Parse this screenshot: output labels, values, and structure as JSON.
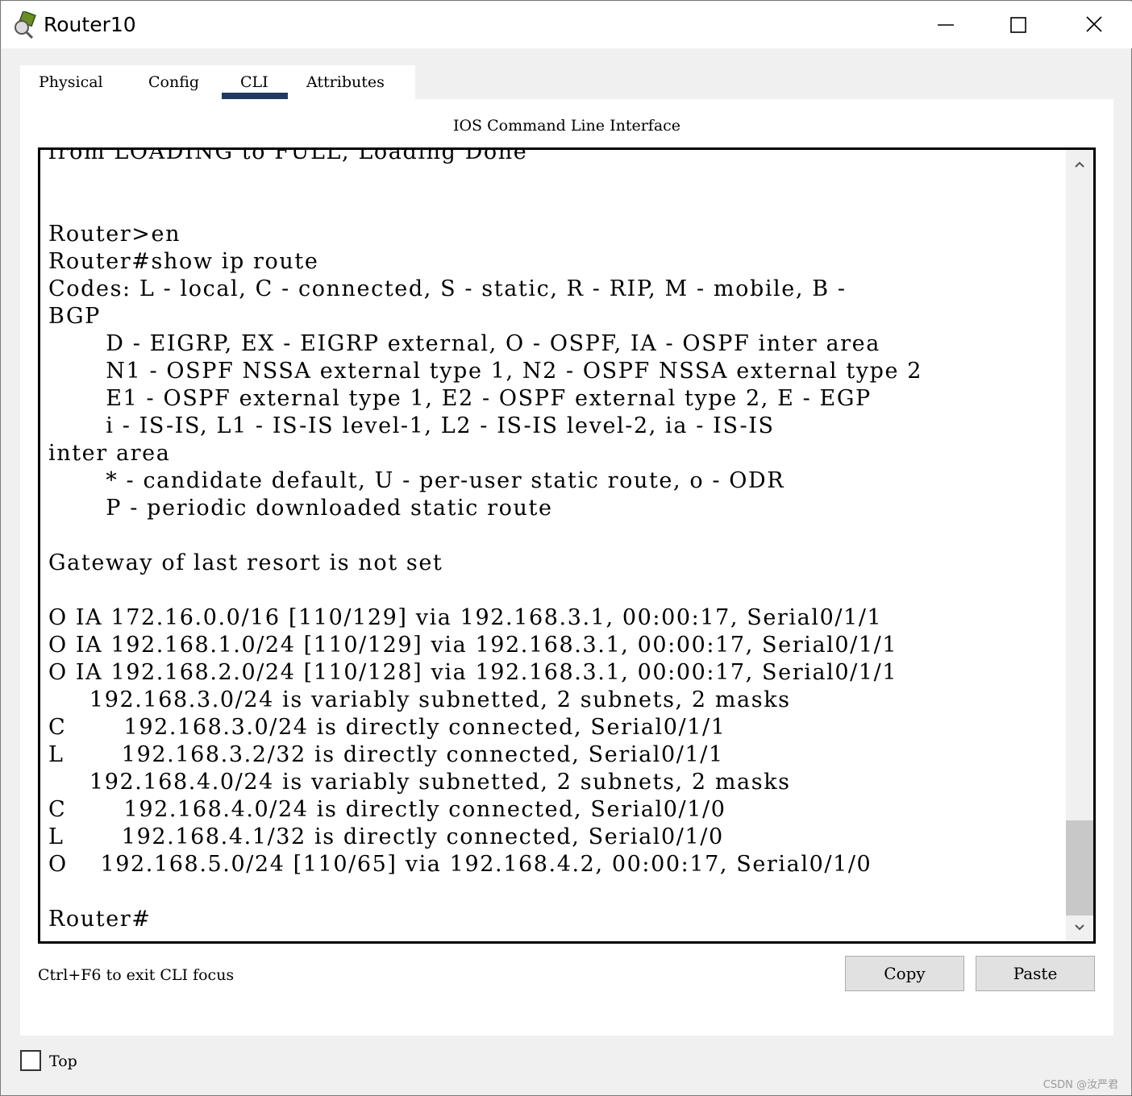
{
  "window": {
    "title": "Router10",
    "icons": {
      "app": "router-app-icon",
      "minimize": "minimize-icon",
      "maximize": "maximize-icon",
      "close": "close-icon"
    }
  },
  "tabs": [
    {
      "label": "Physical"
    },
    {
      "label": "Config"
    },
    {
      "label": "CLI",
      "active": true
    },
    {
      "label": "Attributes"
    }
  ],
  "cli": {
    "heading": "IOS Command Line Interface",
    "lines": [
      "from LOADING to FULL, Loading Done",
      "",
      "",
      "Router>en",
      "Router#show ip route",
      "Codes: L - local, C - connected, S - static, R - RIP, M - mobile, B -",
      "BGP",
      "       D - EIGRP, EX - EIGRP external, O - OSPF, IA - OSPF inter area",
      "       N1 - OSPF NSSA external type 1, N2 - OSPF NSSA external type 2",
      "       E1 - OSPF external type 1, E2 - OSPF external type 2, E - EGP",
      "       i - IS-IS, L1 - IS-IS level-1, L2 - IS-IS level-2, ia - IS-IS",
      "inter area",
      "       * - candidate default, U - per-user static route, o - ODR",
      "       P - periodic downloaded static route",
      "",
      "Gateway of last resort is not set",
      "",
      "O IA 172.16.0.0/16 [110/129] via 192.168.3.1, 00:00:17, Serial0/1/1",
      "O IA 192.168.1.0/24 [110/129] via 192.168.3.1, 00:00:17, Serial0/1/1",
      "O IA 192.168.2.0/24 [110/128] via 192.168.3.1, 00:00:17, Serial0/1/1",
      "     192.168.3.0/24 is variably subnetted, 2 subnets, 2 masks",
      "C       192.168.3.0/24 is directly connected, Serial0/1/1",
      "L       192.168.3.2/32 is directly connected, Serial0/1/1",
      "     192.168.4.0/24 is variably subnetted, 2 subnets, 2 masks",
      "C       192.168.4.0/24 is directly connected, Serial0/1/0",
      "L       192.168.4.1/32 is directly connected, Serial0/1/0",
      "O    192.168.5.0/24 [110/65] via 192.168.4.2, 00:00:17, Serial0/1/0",
      "",
      "Router#"
    ],
    "scroll_position": 0.95
  },
  "footer": {
    "hint": "Ctrl+F6 to exit CLI focus",
    "copy_label": "Copy",
    "paste_label": "Paste"
  },
  "bottom": {
    "top_checkbox_label": "Top",
    "top_checked": false,
    "watermark": "CSDN @汝严君"
  }
}
